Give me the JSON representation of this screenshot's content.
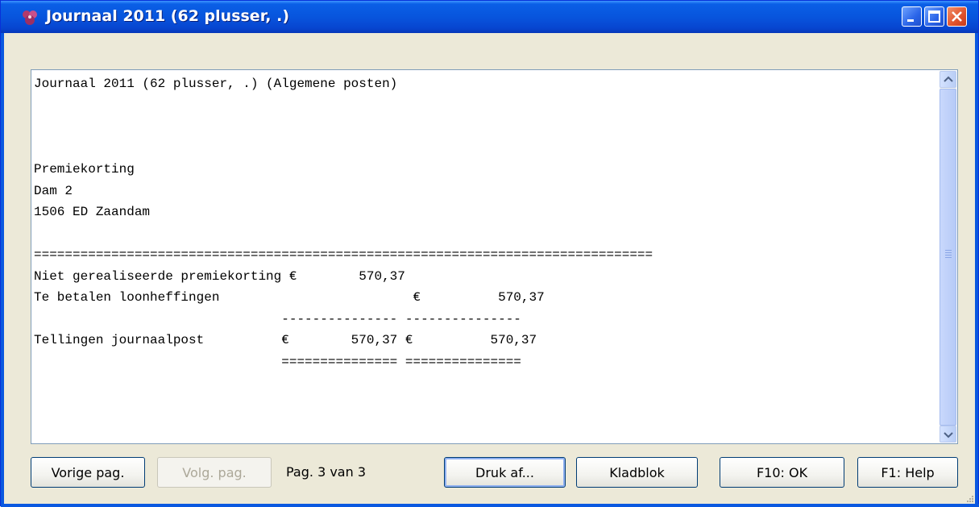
{
  "window": {
    "title": "Journaal 2011 (62 plusser, .)",
    "icon": "app-icon"
  },
  "report": {
    "lines": [
      "Journaal 2011 (62 plusser, .) (Algemene posten)",
      "",
      "",
      "",
      "Premiekorting",
      "Dam 2",
      "1506 ED Zaandam",
      "",
      "================================================================================",
      "Niet gerealiseerde premiekorting €        570,37",
      "Te betalen loonheffingen                         €          570,37",
      "                                --------------- ---------------",
      "Tellingen journaalpost          €        570,37 €          570,37",
      "                                =============== ==============="
    ]
  },
  "buttons": {
    "prev_page": "Vorige pag.",
    "next_page": "Volg. pag.",
    "print": "Druk af...",
    "notepad": "Kladblok",
    "ok": "F10: OK",
    "help": "F1: Help"
  },
  "pagination": {
    "label": "Pag. 3 van 3"
  },
  "colors": {
    "titlebar": "#0855dd",
    "face": "#ece9d8",
    "close": "#e1522c"
  }
}
